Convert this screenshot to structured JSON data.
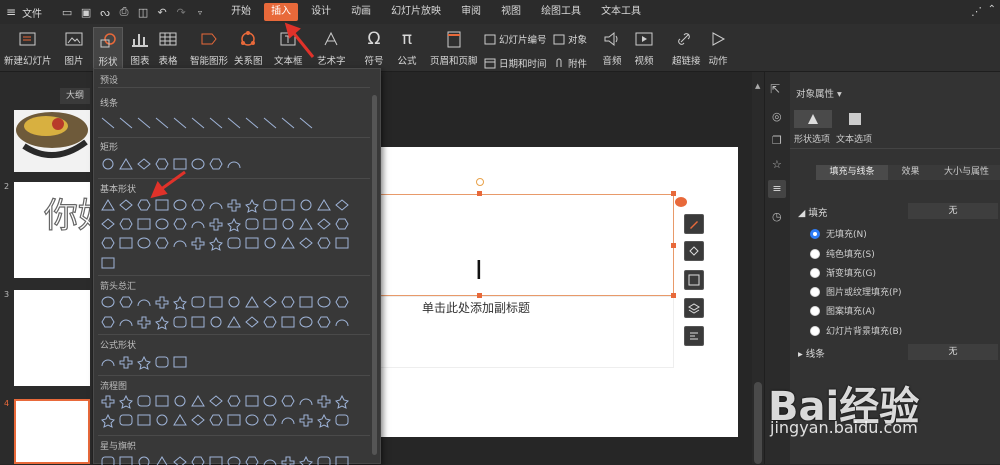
{
  "menubar": {
    "file": "文件",
    "tabs": [
      "开始",
      "插入",
      "设计",
      "动画",
      "幻灯片放映",
      "审阅",
      "视图",
      "绘图工具",
      "文本工具"
    ],
    "active": "插入"
  },
  "ribbon": {
    "new_slide": "新建幻灯片",
    "picture": "图片",
    "shape": "形状",
    "chart": "图表",
    "table": "表格",
    "smartart": "智能图形",
    "relation": "关系图",
    "textbox": "文本框",
    "wordart": "艺术字",
    "symbol": "符号",
    "formula": "公式",
    "header_footer": "页眉和页脚",
    "slide_number": "幻灯片编号",
    "object": "对象",
    "datetime": "日期和时间",
    "attachment": "附件",
    "audio": "音频",
    "video": "视频",
    "hyperlink": "超链接",
    "action": "动作"
  },
  "left": {
    "outline_tab": "大纲",
    "thumbs": [
      {
        "num": "2",
        "text": "你好"
      },
      {
        "num": "3"
      },
      {
        "num": "4"
      }
    ]
  },
  "shapes": {
    "preset": "预设",
    "sections": [
      "线条",
      "矩形",
      "基本形状",
      "箭头总汇",
      "公式形状",
      "流程图",
      "星与旗帜"
    ]
  },
  "slide": {
    "cursor_text": "I",
    "subtitle": "单击此处添加副标题"
  },
  "panel": {
    "title": "对象属性",
    "tab_shape": "形状选项",
    "tab_text": "文本选项",
    "sub_tabs": [
      "填充与线条",
      "效果",
      "大小与属性"
    ],
    "fill_label": "填充",
    "fill_value": "无",
    "options": [
      "无填充(N)",
      "纯色填充(S)",
      "渐变填充(G)",
      "图片或纹理填充(P)",
      "图案填充(A)",
      "幻灯片背景填充(B)"
    ],
    "line_label": "线条",
    "line_value": "无"
  },
  "watermark": {
    "brand": "Bai经验",
    "url": "jingyan.baidu.com"
  },
  "colors": {
    "accent": "#e8693a",
    "red_arrow": "#e0322a",
    "radio_selected": "#2f7df6"
  }
}
